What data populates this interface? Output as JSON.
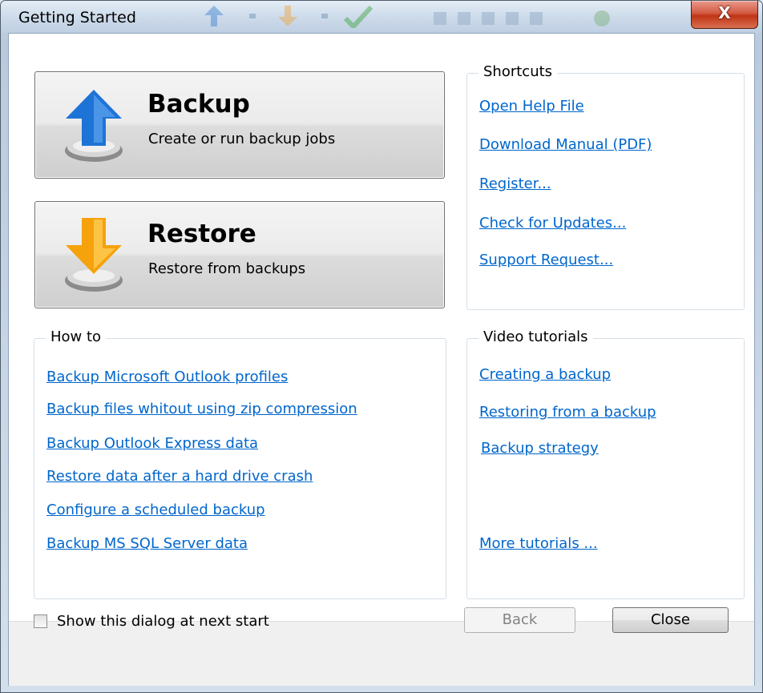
{
  "window": {
    "title": "Getting Started",
    "close_glyph": "X"
  },
  "actions": {
    "backup": {
      "title": "Backup",
      "subtitle": "Create or run backup jobs",
      "icon": "backup-up-arrow-icon"
    },
    "restore": {
      "title": "Restore",
      "subtitle": "Restore from backups",
      "icon": "restore-down-arrow-icon"
    }
  },
  "shortcuts": {
    "title": "Shortcuts",
    "links": [
      "Open Help File",
      "Download Manual (PDF)",
      "Register...",
      "Check for Updates...",
      "Support Request..."
    ]
  },
  "howto": {
    "title": "How to",
    "links": [
      "Backup Microsoft Outlook profiles",
      "Backup files whitout using zip compression",
      "Backup Outlook Express data",
      "Restore data after a hard drive crash",
      "Configure a scheduled backup",
      "Backup MS SQL Server data"
    ]
  },
  "videos": {
    "title": "Video tutorials",
    "links": [
      "Creating a backup",
      "Restoring from a backup",
      "Backup strategy"
    ],
    "more": "More tutorials ..."
  },
  "footer": {
    "show_checkbox_label": "Show this dialog at next start",
    "show_checked": false,
    "back_label": "Back",
    "close_label": "Close"
  },
  "colors": {
    "link": "#0066cc",
    "backup_icon": "#1e73d6",
    "restore_icon": "#f5a20c"
  }
}
